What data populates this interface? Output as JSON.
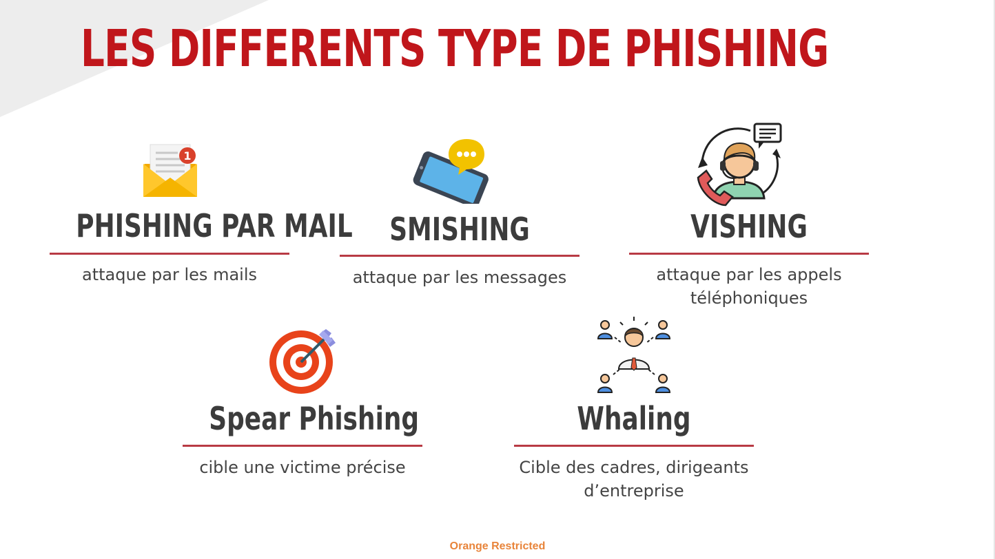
{
  "slide": {
    "title": "LES DIFFERENTS TYPE DE PHISHING",
    "footer": "Orange Restricted",
    "colors": {
      "title": "#c0161b",
      "heading": "#3c3c3c",
      "rule": "#b83a44",
      "footer": "#e8843a"
    }
  },
  "cards": [
    {
      "heading": "PHISHING PAR MAIL",
      "description": "attaque par les mails",
      "icon": "envelope-notification-icon"
    },
    {
      "heading": "SMISHING",
      "description": "attaque par les messages",
      "icon": "phone-message-icon"
    },
    {
      "heading": "VISHING",
      "description": "attaque par les appels téléphoniques",
      "icon": "call-center-agent-icon"
    },
    {
      "heading": "Spear Phishing",
      "description": "cible une victime précise",
      "icon": "target-dart-icon"
    },
    {
      "heading": "Whaling",
      "description": "Cible des cadres, dirigeants d’entreprise",
      "icon": "executive-network-icon"
    }
  ]
}
